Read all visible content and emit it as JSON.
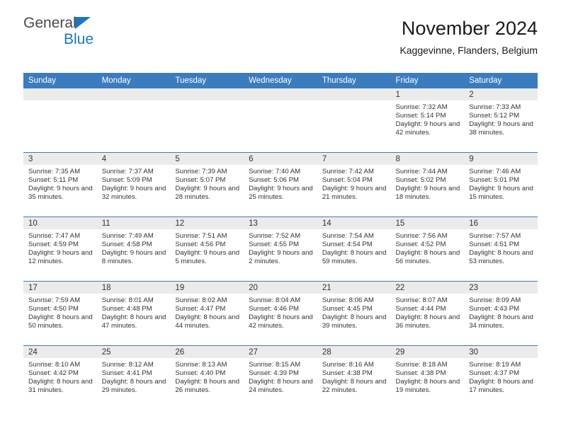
{
  "brand": {
    "name_part1": "General",
    "name_part2": "Blue",
    "accent_color": "#1d76c4"
  },
  "header": {
    "title": "November 2024",
    "subtitle": "Kaggevinne, Flanders, Belgium"
  },
  "calendar": {
    "header_color": "#3a7cbe",
    "date_band_color": "#ebebeb",
    "weekday_names": [
      "Sunday",
      "Monday",
      "Tuesday",
      "Wednesday",
      "Thursday",
      "Friday",
      "Saturday"
    ],
    "weeks": [
      [
        {
          "empty": true
        },
        {
          "empty": true
        },
        {
          "empty": true
        },
        {
          "empty": true
        },
        {
          "empty": true
        },
        {
          "date": "1",
          "sunrise": "Sunrise: 7:32 AM",
          "sunset": "Sunset: 5:14 PM",
          "daylight": "Daylight: 9 hours and 42 minutes."
        },
        {
          "date": "2",
          "sunrise": "Sunrise: 7:33 AM",
          "sunset": "Sunset: 5:12 PM",
          "daylight": "Daylight: 9 hours and 38 minutes."
        }
      ],
      [
        {
          "date": "3",
          "sunrise": "Sunrise: 7:35 AM",
          "sunset": "Sunset: 5:11 PM",
          "daylight": "Daylight: 9 hours and 35 minutes."
        },
        {
          "date": "4",
          "sunrise": "Sunrise: 7:37 AM",
          "sunset": "Sunset: 5:09 PM",
          "daylight": "Daylight: 9 hours and 32 minutes."
        },
        {
          "date": "5",
          "sunrise": "Sunrise: 7:39 AM",
          "sunset": "Sunset: 5:07 PM",
          "daylight": "Daylight: 9 hours and 28 minutes."
        },
        {
          "date": "6",
          "sunrise": "Sunrise: 7:40 AM",
          "sunset": "Sunset: 5:06 PM",
          "daylight": "Daylight: 9 hours and 25 minutes."
        },
        {
          "date": "7",
          "sunrise": "Sunrise: 7:42 AM",
          "sunset": "Sunset: 5:04 PM",
          "daylight": "Daylight: 9 hours and 21 minutes."
        },
        {
          "date": "8",
          "sunrise": "Sunrise: 7:44 AM",
          "sunset": "Sunset: 5:02 PM",
          "daylight": "Daylight: 9 hours and 18 minutes."
        },
        {
          "date": "9",
          "sunrise": "Sunrise: 7:46 AM",
          "sunset": "Sunset: 5:01 PM",
          "daylight": "Daylight: 9 hours and 15 minutes."
        }
      ],
      [
        {
          "date": "10",
          "sunrise": "Sunrise: 7:47 AM",
          "sunset": "Sunset: 4:59 PM",
          "daylight": "Daylight: 9 hours and 12 minutes."
        },
        {
          "date": "11",
          "sunrise": "Sunrise: 7:49 AM",
          "sunset": "Sunset: 4:58 PM",
          "daylight": "Daylight: 9 hours and 8 minutes."
        },
        {
          "date": "12",
          "sunrise": "Sunrise: 7:51 AM",
          "sunset": "Sunset: 4:56 PM",
          "daylight": "Daylight: 9 hours and 5 minutes."
        },
        {
          "date": "13",
          "sunrise": "Sunrise: 7:52 AM",
          "sunset": "Sunset: 4:55 PM",
          "daylight": "Daylight: 9 hours and 2 minutes."
        },
        {
          "date": "14",
          "sunrise": "Sunrise: 7:54 AM",
          "sunset": "Sunset: 4:54 PM",
          "daylight": "Daylight: 8 hours and 59 minutes."
        },
        {
          "date": "15",
          "sunrise": "Sunrise: 7:56 AM",
          "sunset": "Sunset: 4:52 PM",
          "daylight": "Daylight: 8 hours and 56 minutes."
        },
        {
          "date": "16",
          "sunrise": "Sunrise: 7:57 AM",
          "sunset": "Sunset: 4:51 PM",
          "daylight": "Daylight: 8 hours and 53 minutes."
        }
      ],
      [
        {
          "date": "17",
          "sunrise": "Sunrise: 7:59 AM",
          "sunset": "Sunset: 4:50 PM",
          "daylight": "Daylight: 8 hours and 50 minutes."
        },
        {
          "date": "18",
          "sunrise": "Sunrise: 8:01 AM",
          "sunset": "Sunset: 4:48 PM",
          "daylight": "Daylight: 8 hours and 47 minutes."
        },
        {
          "date": "19",
          "sunrise": "Sunrise: 8:02 AM",
          "sunset": "Sunset: 4:47 PM",
          "daylight": "Daylight: 8 hours and 44 minutes."
        },
        {
          "date": "20",
          "sunrise": "Sunrise: 8:04 AM",
          "sunset": "Sunset: 4:46 PM",
          "daylight": "Daylight: 8 hours and 42 minutes."
        },
        {
          "date": "21",
          "sunrise": "Sunrise: 8:06 AM",
          "sunset": "Sunset: 4:45 PM",
          "daylight": "Daylight: 8 hours and 39 minutes."
        },
        {
          "date": "22",
          "sunrise": "Sunrise: 8:07 AM",
          "sunset": "Sunset: 4:44 PM",
          "daylight": "Daylight: 8 hours and 36 minutes."
        },
        {
          "date": "23",
          "sunrise": "Sunrise: 8:09 AM",
          "sunset": "Sunset: 4:43 PM",
          "daylight": "Daylight: 8 hours and 34 minutes."
        }
      ],
      [
        {
          "date": "24",
          "sunrise": "Sunrise: 8:10 AM",
          "sunset": "Sunset: 4:42 PM",
          "daylight": "Daylight: 8 hours and 31 minutes."
        },
        {
          "date": "25",
          "sunrise": "Sunrise: 8:12 AM",
          "sunset": "Sunset: 4:41 PM",
          "daylight": "Daylight: 8 hours and 29 minutes."
        },
        {
          "date": "26",
          "sunrise": "Sunrise: 8:13 AM",
          "sunset": "Sunset: 4:40 PM",
          "daylight": "Daylight: 8 hours and 26 minutes."
        },
        {
          "date": "27",
          "sunrise": "Sunrise: 8:15 AM",
          "sunset": "Sunset: 4:39 PM",
          "daylight": "Daylight: 8 hours and 24 minutes."
        },
        {
          "date": "28",
          "sunrise": "Sunrise: 8:16 AM",
          "sunset": "Sunset: 4:38 PM",
          "daylight": "Daylight: 8 hours and 22 minutes."
        },
        {
          "date": "29",
          "sunrise": "Sunrise: 8:18 AM",
          "sunset": "Sunset: 4:38 PM",
          "daylight": "Daylight: 8 hours and 19 minutes."
        },
        {
          "date": "30",
          "sunrise": "Sunrise: 8:19 AM",
          "sunset": "Sunset: 4:37 PM",
          "daylight": "Daylight: 8 hours and 17 minutes."
        }
      ]
    ]
  }
}
